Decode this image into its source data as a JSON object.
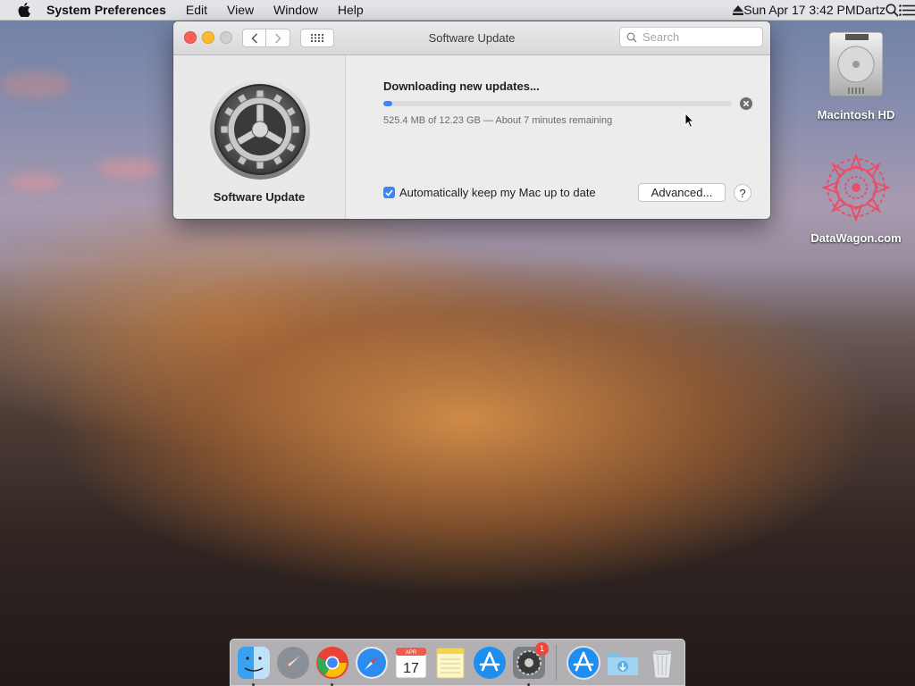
{
  "menubar": {
    "app_name": "System Preferences",
    "items": [
      "Edit",
      "View",
      "Window",
      "Help"
    ],
    "clock": "Sun Apr 17  3:42 PM",
    "user": "Dartz"
  },
  "window": {
    "title": "Software Update",
    "search_placeholder": "Search",
    "sidebar_label": "Software Update",
    "status": "Downloading new updates...",
    "progress_fraction": 0.025,
    "detail": "525.4 MB of 12.23 GB — About 7 minutes remaining",
    "auto_update_label": "Automatically keep my Mac up to date",
    "auto_update_checked": true,
    "advanced_label": "Advanced...",
    "help_label": "?"
  },
  "desktop": {
    "icons": [
      {
        "label": "Macintosh HD"
      },
      {
        "label": "DataWagon.com"
      }
    ]
  },
  "dock": {
    "calendar_month": "APR",
    "calendar_day": "17",
    "settings_badge": "1"
  },
  "colors": {
    "accent": "#3b86f7",
    "close": "#fc5f57",
    "minimize": "#fdbc2e"
  }
}
